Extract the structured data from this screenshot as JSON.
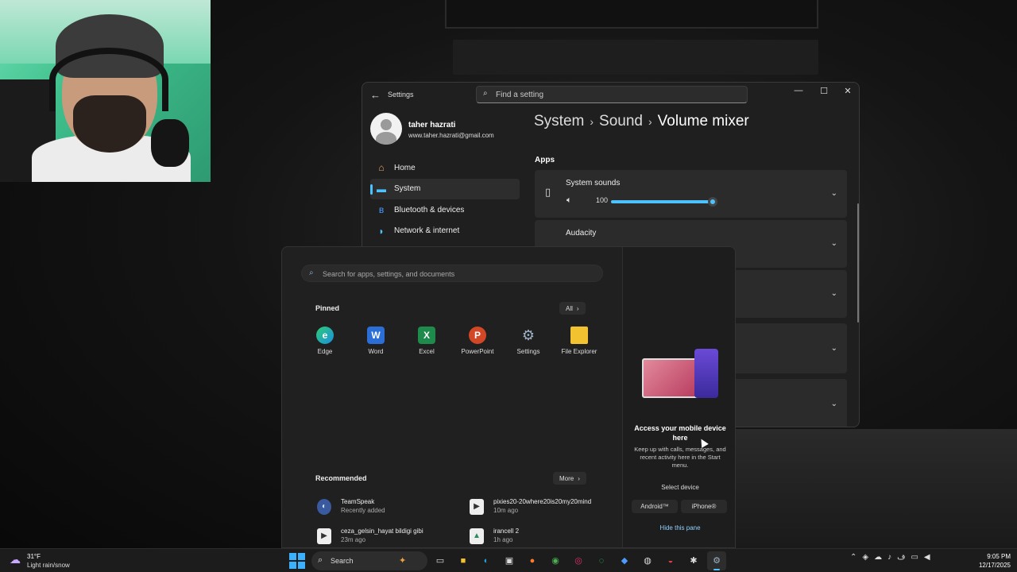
{
  "webcam": {
    "person": "streamer with headset"
  },
  "settings": {
    "title": "Settings",
    "search_placeholder": "Find a setting",
    "profile": {
      "name": "taher hazrati",
      "email": "www.taher.hazrati@gmail.com"
    },
    "nav": [
      {
        "label": "Home",
        "icon": "home-icon",
        "active": false
      },
      {
        "label": "System",
        "icon": "system-icon",
        "active": true
      },
      {
        "label": "Bluetooth & devices",
        "icon": "bluetooth-icon",
        "active": false
      },
      {
        "label": "Network & internet",
        "icon": "network-icon",
        "active": false
      }
    ],
    "breadcrumb": [
      "System",
      "Sound",
      "Volume mixer"
    ],
    "apps_header": "Apps",
    "apps": [
      {
        "name": "System sounds",
        "volume": 100
      },
      {
        "name": "Audacity"
      }
    ],
    "accent": "#4cc2ff"
  },
  "start_menu": {
    "search_placeholder": "Search for apps, settings, and documents",
    "pinned_header": "Pinned",
    "all_label": "All",
    "pinned": [
      {
        "label": "Edge",
        "icon": "edge-icon",
        "color": "#1fa0e0"
      },
      {
        "label": "Word",
        "icon": "word-icon",
        "color": "#2b6fd6"
      },
      {
        "label": "Excel",
        "icon": "excel-icon",
        "color": "#1e8a4c"
      },
      {
        "label": "PowerPoint",
        "icon": "powerpoint-icon",
        "color": "#d24726"
      },
      {
        "label": "Settings",
        "icon": "gear-icon",
        "color": "#6b7b8c"
      },
      {
        "label": "File Explorer",
        "icon": "folder-icon",
        "color": "#f2c230"
      }
    ],
    "recommended_header": "Recommended",
    "more_label": "More",
    "recommended": [
      {
        "name": "TeamSpeak",
        "sub": "Recently added",
        "icon": "teamspeak-icon"
      },
      {
        "name": "pixies20-20where20is20my20mind",
        "sub": "10m ago",
        "icon": "media-file-icon"
      },
      {
        "name": "ceza_gelsin_hayat bildigi gibi",
        "sub": "23m ago",
        "icon": "media-file-icon"
      },
      {
        "name": "irancell 2",
        "sub": "1h ago",
        "icon": "image-file-icon"
      }
    ],
    "phone_link": {
      "title": "Access your mobile device here",
      "description": "Keep up with calls, messages, and recent activity here in the Start menu.",
      "select_device": "Select device",
      "options": [
        "Android™",
        "iPhone®"
      ],
      "hide": "Hide this pane"
    }
  },
  "taskbar": {
    "weather": {
      "temp": "31°F",
      "condition": "Light rain/snow"
    },
    "search_label": "Search",
    "apps": [
      {
        "name": "task-view-icon",
        "glyph": "▭"
      },
      {
        "name": "file-explorer-icon",
        "glyph": "■"
      },
      {
        "name": "edge-icon",
        "glyph": "◐"
      },
      {
        "name": "store-icon",
        "glyph": "▣"
      },
      {
        "name": "firefox-icon",
        "glyph": "●"
      },
      {
        "name": "chrome-icon",
        "glyph": "◉"
      },
      {
        "name": "instagram-icon",
        "glyph": "◎"
      },
      {
        "name": "whatsapp-icon",
        "glyph": "◌"
      },
      {
        "name": "shield-icon",
        "glyph": "◆"
      },
      {
        "name": "obs-icon",
        "glyph": "◍"
      },
      {
        "name": "app-icon",
        "glyph": "◒"
      },
      {
        "name": "app-icon-2",
        "glyph": "✱"
      },
      {
        "name": "settings-icon",
        "glyph": "⚙"
      }
    ],
    "time": "9:05 PM",
    "date": "12/17/2025"
  }
}
